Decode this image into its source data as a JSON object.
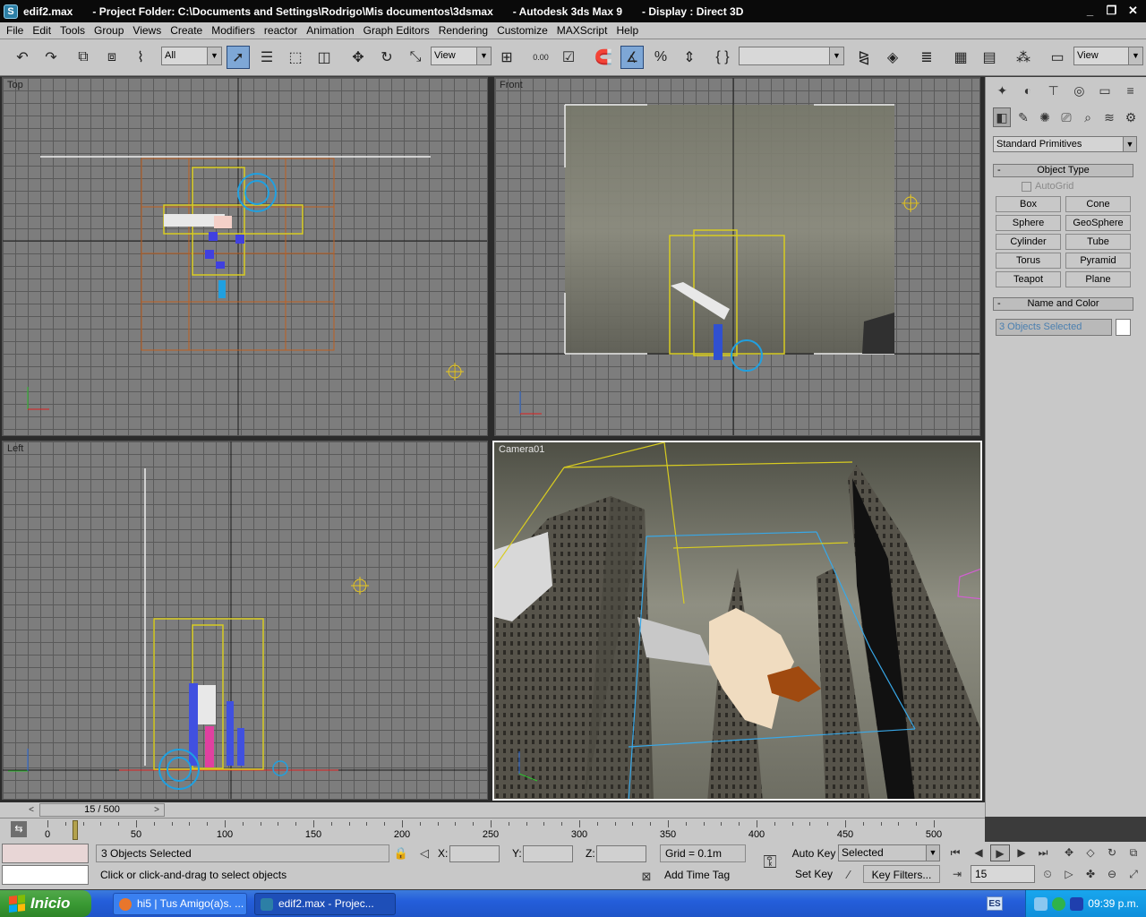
{
  "window": {
    "file_name": "edif2.max",
    "project_folder": "- Project Folder: C:\\Documents and Settings\\Rodrigo\\Mis documentos\\3dsmax",
    "app_name": "- Autodesk 3ds Max 9",
    "display": "- Display : Direct 3D",
    "minimize": "_",
    "restore": "❐",
    "close": "✕"
  },
  "menu": [
    "File",
    "Edit",
    "Tools",
    "Group",
    "Views",
    "Create",
    "Modifiers",
    "reactor",
    "Animation",
    "Graph Editors",
    "Rendering",
    "Customize",
    "MAXScript",
    "Help"
  ],
  "toolbar": {
    "selection_filter": "All",
    "reference_coord": "View",
    "snap_value": "0.00",
    "named_selection": "",
    "view_combo": "View"
  },
  "viewports": {
    "top": "Top",
    "front": "Front",
    "left": "Left",
    "camera": "Camera01"
  },
  "command_panel": {
    "category": "Standard Primitives",
    "object_type_header": "Object Type",
    "autogrid": "AutoGrid",
    "primitives": [
      [
        "Box",
        "Cone"
      ],
      [
        "Sphere",
        "GeoSphere"
      ],
      [
        "Cylinder",
        "Tube"
      ],
      [
        "Torus",
        "Pyramid"
      ],
      [
        "Teapot",
        "Plane"
      ]
    ],
    "name_color_header": "Name and Color",
    "name_value": "3 Objects Selected",
    "rollout_minus": "-",
    "swatch_color": "#ffffff"
  },
  "time_slider": {
    "frame_display": "15 / 500",
    "prev": "<",
    "next": ">"
  },
  "trackbar": {
    "ticks": [
      "0",
      "50",
      "100",
      "150",
      "200",
      "250",
      "300",
      "350",
      "400",
      "450",
      "500"
    ]
  },
  "status": {
    "selection_count": "3 Objects Selected",
    "prompt": "Click or click-and-drag to select objects",
    "x_label": "X:",
    "y_label": "Y:",
    "z_label": "Z:",
    "grid": "Grid = 0.1m",
    "add_time_tag": "Add Time Tag",
    "auto_key": "Auto Key",
    "set_key": "Set Key",
    "key_mode": "Selected",
    "key_filters": "Key Filters...",
    "current_frame": "15"
  },
  "taskbar": {
    "start": "Inicio",
    "tasks": [
      "hi5 | Tus Amigo(a)s. ...",
      "edif2.max     - Projec..."
    ],
    "language": "ES",
    "time": "09:39 p.m."
  }
}
